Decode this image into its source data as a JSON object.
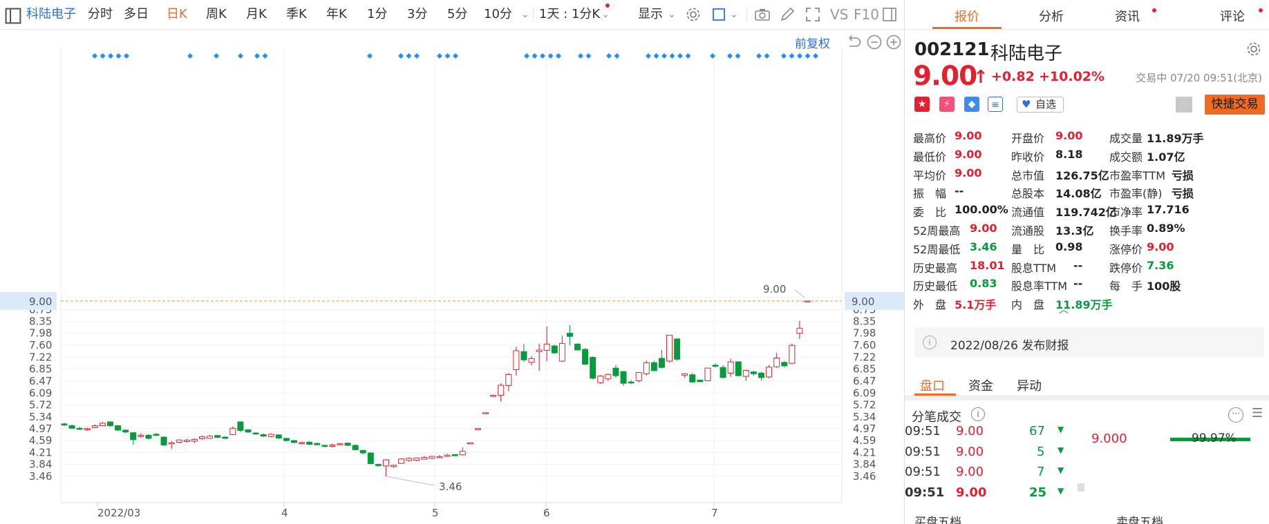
{
  "toolbar": {
    "stock_name": "科陆电子",
    "periods": [
      "分时",
      "多日",
      "日K",
      "周K",
      "月K",
      "季K",
      "年K",
      "1分",
      "3分",
      "5分",
      "10分"
    ],
    "active_period": "日K",
    "range_select": "1天 : 1分K",
    "display_label": "显示",
    "vs_label": "VS",
    "f10_label": "F10",
    "adjust_label": "前复权"
  },
  "chart_data": {
    "type": "candlestick",
    "y_ticks": [
      "3.46",
      "3.84",
      "4.21",
      "4.59",
      "4.97",
      "5.34",
      "5.72",
      "6.09",
      "6.47",
      "6.85",
      "7.22",
      "7.60",
      "7.98",
      "8.35",
      "8.73",
      "9.11"
    ],
    "x_labels": [
      "2022/03",
      "4",
      "5",
      "6",
      "7"
    ],
    "current_price_line": "9.00",
    "max_label": "9.00",
    "min_label": "3.46",
    "ylim": [
      3.15,
      9.2
    ],
    "candles": [
      [
        5.12,
        5.08,
        5.15,
        5.05
      ],
      [
        5.06,
        4.98,
        5.1,
        4.95
      ],
      [
        4.98,
        4.95,
        5.02,
        4.92
      ],
      [
        4.93,
        4.97,
        5.0,
        4.9
      ],
      [
        5.0,
        5.06,
        5.1,
        4.98
      ],
      [
        5.06,
        5.14,
        5.18,
        5.04
      ],
      [
        5.18,
        5.06,
        5.2,
        5.02
      ],
      [
        5.06,
        4.92,
        5.08,
        4.9
      ],
      [
        4.92,
        4.86,
        4.95,
        4.82
      ],
      [
        4.84,
        4.62,
        4.86,
        4.46
      ],
      [
        4.72,
        4.76,
        4.82,
        4.68
      ],
      [
        4.76,
        4.66,
        4.79,
        4.62
      ],
      [
        4.79,
        4.78,
        4.83,
        4.73
      ],
      [
        4.7,
        4.45,
        4.73,
        4.42
      ],
      [
        4.49,
        4.52,
        4.58,
        4.33
      ],
      [
        4.54,
        4.61,
        4.63,
        4.51
      ],
      [
        4.56,
        4.6,
        4.64,
        4.53
      ],
      [
        4.57,
        4.63,
        4.66,
        4.51
      ],
      [
        4.65,
        4.71,
        4.75,
        4.62
      ],
      [
        4.66,
        4.73,
        4.77,
        4.64
      ],
      [
        4.75,
        4.69,
        4.78,
        4.67
      ],
      [
        4.7,
        4.66,
        4.73,
        4.63
      ],
      [
        4.78,
        4.98,
        5.04,
        4.76
      ],
      [
        5.18,
        4.91,
        5.2,
        4.85
      ],
      [
        4.93,
        4.86,
        4.95,
        4.83
      ],
      [
        4.83,
        4.8,
        4.86,
        4.77
      ],
      [
        4.78,
        4.73,
        4.82,
        4.7
      ],
      [
        4.72,
        4.79,
        4.82,
        4.69
      ],
      [
        4.77,
        4.67,
        4.79,
        4.64
      ],
      [
        4.66,
        4.59,
        4.68,
        4.56
      ],
      [
        4.59,
        4.53,
        4.61,
        4.5
      ],
      [
        4.5,
        4.53,
        4.56,
        4.47
      ],
      [
        4.54,
        4.47,
        4.57,
        4.45
      ],
      [
        4.5,
        4.46,
        4.53,
        4.44
      ],
      [
        4.44,
        4.41,
        4.46,
        4.37
      ],
      [
        4.41,
        4.45,
        4.49,
        4.38
      ],
      [
        4.48,
        4.49,
        4.52,
        4.45
      ],
      [
        4.51,
        4.44,
        4.53,
        4.42
      ],
      [
        4.44,
        4.3,
        4.47,
        4.28
      ],
      [
        4.28,
        4.2,
        4.3,
        4.15
      ],
      [
        4.2,
        3.86,
        4.22,
        3.84
      ],
      [
        3.84,
        3.8,
        3.86,
        3.76
      ],
      [
        3.79,
        3.98,
        4.01,
        3.46
      ],
      [
        3.77,
        3.81,
        3.83,
        3.73
      ],
      [
        3.87,
        4.01,
        4.02,
        3.86
      ],
      [
        3.96,
        4.03,
        4.06,
        3.92
      ],
      [
        3.97,
        4.04,
        4.06,
        3.94
      ],
      [
        4.0,
        4.06,
        4.1,
        4.0
      ],
      [
        4.03,
        4.09,
        4.11,
        4.01
      ],
      [
        4.07,
        4.08,
        4.14,
        4.04
      ],
      [
        4.09,
        4.13,
        4.17,
        4.07
      ],
      [
        4.15,
        4.11,
        4.16,
        4.1
      ],
      [
        4.14,
        4.25,
        4.38,
        4.12
      ],
      [
        4.52,
        4.52,
        4.52,
        4.52
      ],
      [
        4.97,
        4.97,
        4.97,
        4.97
      ],
      [
        5.47,
        5.47,
        5.47,
        5.47
      ],
      [
        6.02,
        6.02,
        6.02,
        6.02
      ],
      [
        6.02,
        6.34,
        6.4,
        5.82
      ],
      [
        6.33,
        6.68,
        6.72,
        6.15
      ],
      [
        6.83,
        7.43,
        7.55,
        6.64
      ],
      [
        7.4,
        7.14,
        7.64,
        7.08
      ],
      [
        7.06,
        7.18,
        7.26,
        6.96
      ],
      [
        7.4,
        7.45,
        7.65,
        6.8
      ],
      [
        7.44,
        7.64,
        8.2,
        7.1
      ],
      [
        7.58,
        7.36,
        7.62,
        7.33
      ],
      [
        7.1,
        7.66,
        7.9,
        7.07
      ],
      [
        7.98,
        7.88,
        8.24,
        7.6
      ],
      [
        7.64,
        7.45,
        7.66,
        7.44
      ],
      [
        7.47,
        7.0,
        7.52,
        6.98
      ],
      [
        7.22,
        6.56,
        7.25,
        6.52
      ],
      [
        6.42,
        6.63,
        6.66,
        6.38
      ],
      [
        6.54,
        6.68,
        6.7,
        6.48
      ],
      [
        6.88,
        6.64,
        6.98,
        6.58
      ],
      [
        6.77,
        6.4,
        6.78,
        6.32
      ],
      [
        6.44,
        6.41,
        6.5,
        6.38
      ],
      [
        6.48,
        6.74,
        6.75,
        6.42
      ],
      [
        6.7,
        7.05,
        7.12,
        6.64
      ],
      [
        7.05,
        6.8,
        7.11,
        6.78
      ],
      [
        7.19,
        6.9,
        7.45,
        6.87
      ],
      [
        7.1,
        7.92,
        7.93,
        7.06
      ],
      [
        7.8,
        7.16,
        7.82,
        7.12
      ],
      [
        6.65,
        6.7,
        6.72,
        6.58
      ],
      [
        6.67,
        6.44,
        6.72,
        6.42
      ],
      [
        6.5,
        6.45,
        6.52,
        6.43
      ],
      [
        6.48,
        6.88,
        6.88,
        6.46
      ],
      [
        6.97,
        6.94,
        7.03,
        6.9
      ],
      [
        6.9,
        6.58,
        6.97,
        6.56
      ],
      [
        6.72,
        7.08,
        7.18,
        6.6
      ],
      [
        7.08,
        6.64,
        7.09,
        6.62
      ],
      [
        6.62,
        6.81,
        6.83,
        6.47
      ],
      [
        6.76,
        6.7,
        6.8,
        6.64
      ],
      [
        6.72,
        6.58,
        6.76,
        6.48
      ],
      [
        6.6,
        6.91,
        6.98,
        6.56
      ],
      [
        6.92,
        7.2,
        7.36,
        6.88
      ],
      [
        7.06,
        6.95,
        7.1,
        6.91
      ],
      [
        7.03,
        7.6,
        7.65,
        7.02
      ],
      [
        7.98,
        8.14,
        8.37,
        7.8
      ],
      [
        9.0,
        9.0,
        9.0,
        9.0
      ]
    ],
    "marker_rows": "◆◆◆◆◆"
  },
  "panel": {
    "tabs": [
      "报价",
      "分析",
      "资讯",
      "评论"
    ],
    "code": "002121",
    "name": "科陆电子",
    "price": "9.00",
    "change": "+0.82",
    "change_pct": "+10.02%",
    "status": "交易中 07/20 09:51(北京)",
    "watch_label": "自选",
    "quick_trade": "快捷交易",
    "quote_col1": [
      {
        "label": "最高价",
        "value": "9.00",
        "color": "red"
      },
      {
        "label": "最低价",
        "value": "9.00",
        "color": "red"
      },
      {
        "label": "平均价",
        "value": "9.00",
        "color": "red"
      },
      {
        "label": "振　幅",
        "value": "--",
        "color": "dark"
      },
      {
        "label": "委　比",
        "value": "100.00%",
        "color": "dark"
      },
      {
        "label": "52周最高",
        "value": "9.00",
        "color": "red"
      },
      {
        "label": "52周最低",
        "value": "3.46",
        "color": "green"
      },
      {
        "label": "历史最高",
        "value": "18.01",
        "color": "red"
      },
      {
        "label": "历史最低",
        "value": "0.83",
        "color": "green"
      },
      {
        "label": "外　盘",
        "value": "5.1万手",
        "color": "red"
      }
    ],
    "quote_col2": [
      {
        "label": "开盘价",
        "value": "9.00",
        "color": "red"
      },
      {
        "label": "昨收价",
        "value": "8.18",
        "color": "dark"
      },
      {
        "label": "总市值",
        "value": "126.75亿",
        "color": "dark"
      },
      {
        "label": "总股本",
        "value": "14.08亿",
        "color": "dark"
      },
      {
        "label": "流通值",
        "value": "119.742亿",
        "color": "dark"
      },
      {
        "label": "流通股",
        "value": "13.3亿",
        "color": "dark"
      },
      {
        "label": "量　比",
        "value": "0.98",
        "color": "dark"
      },
      {
        "label": "股息TTM",
        "value": "--",
        "color": "dark"
      },
      {
        "label": "股息率TTM",
        "value": "--",
        "color": "dark"
      },
      {
        "label": "内　盘",
        "value": "11.89万手",
        "color": "green"
      }
    ],
    "quote_col3": [
      {
        "label": "成交量",
        "value": "11.89万手",
        "color": "dark"
      },
      {
        "label": "成交额",
        "value": "1.07亿",
        "color": "dark"
      },
      {
        "label": "市盈率TTM",
        "value": "亏损",
        "color": "dark"
      },
      {
        "label": "市盈率(静)",
        "value": "亏损",
        "color": "dark"
      },
      {
        "label": "市净率",
        "value": "17.716",
        "color": "dark"
      },
      {
        "label": "换手率",
        "value": "0.89%",
        "color": "dark"
      },
      {
        "label": "涨停价",
        "value": "9.00",
        "color": "red"
      },
      {
        "label": "跌停价",
        "value": "7.36",
        "color": "green"
      },
      {
        "label": "每　手",
        "value": "100股",
        "color": "dark"
      }
    ],
    "report": "2022/08/26  发布财报",
    "sub_tabs": [
      "盘口",
      "资金",
      "异动"
    ],
    "ticks_title": "分笔成交",
    "ticks": [
      {
        "time": "09:51",
        "price": "9.00",
        "vol": "67"
      },
      {
        "time": "09:51",
        "price": "9.00",
        "vol": "5"
      },
      {
        "time": "09:51",
        "price": "9.00",
        "vol": "7"
      },
      {
        "time": "09:51",
        "price": "9.00",
        "vol": "25"
      }
    ],
    "vol_price": "9.000",
    "vol_pct": "99.97%",
    "buy5": "买盘五档",
    "sell5": "卖盘五档"
  },
  "colors": {
    "up": "#e4202e",
    "down": "#0a9a3e",
    "accent": "#f26a21",
    "link": "#2f6fd6",
    "marker": "#1e8fff"
  }
}
